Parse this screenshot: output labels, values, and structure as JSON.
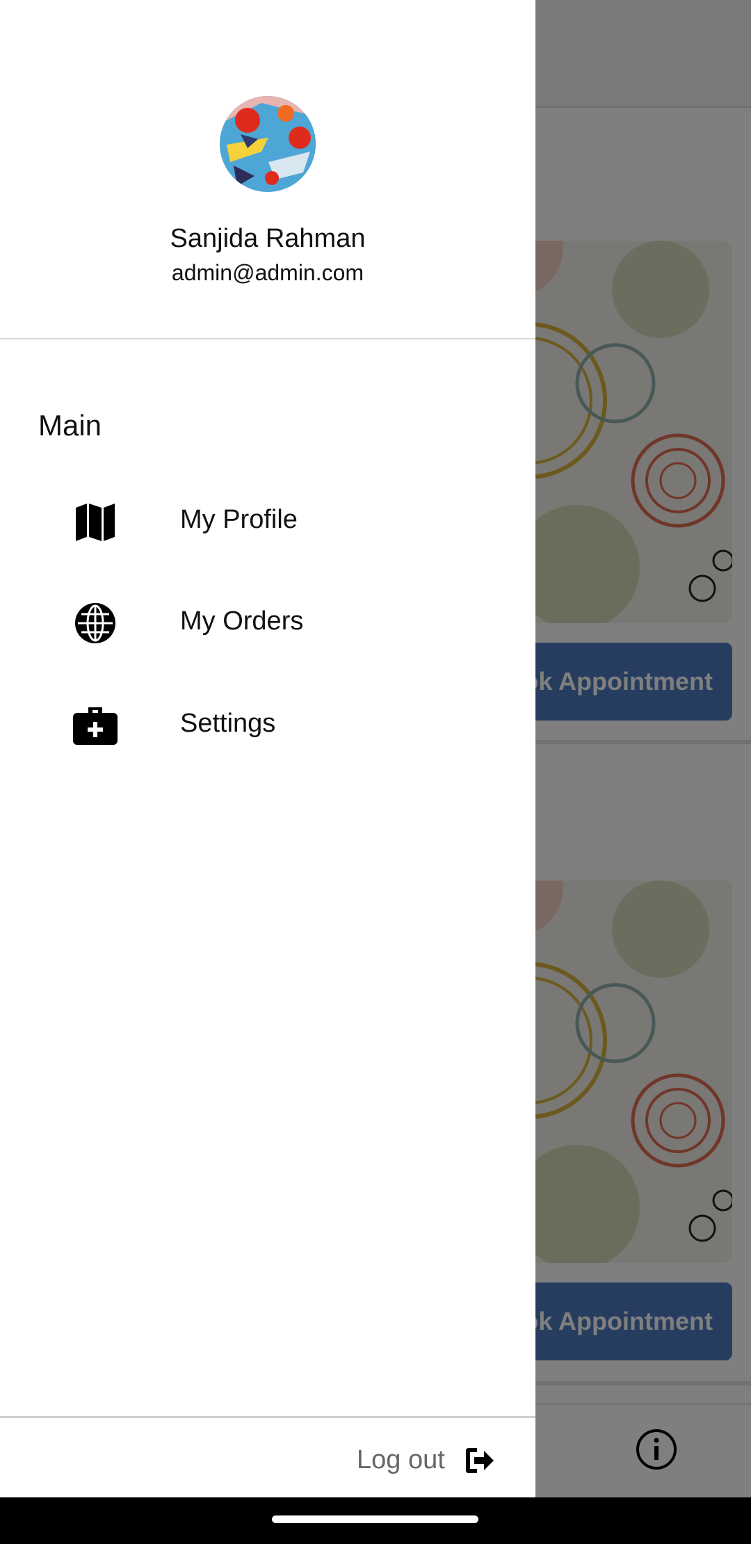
{
  "app": {
    "cards": [
      {
        "button_label": "Book Appointment"
      },
      {
        "button_label": "Book Appointment"
      }
    ]
  },
  "drawer": {
    "user": {
      "name": "Sanjida Rahman",
      "email": "admin@admin.com"
    },
    "section_label": "Main",
    "items": [
      {
        "label": "My Profile",
        "icon": "map-icon"
      },
      {
        "label": "My Orders",
        "icon": "globe-icon"
      },
      {
        "label": "Settings",
        "icon": "medical-case-icon"
      }
    ],
    "logout_label": "Log out"
  },
  "colors": {
    "overlay": "rgba(0,0,0,0.5)",
    "button": "#4f7bbf",
    "text": "#111111",
    "logout_text": "#666666"
  }
}
